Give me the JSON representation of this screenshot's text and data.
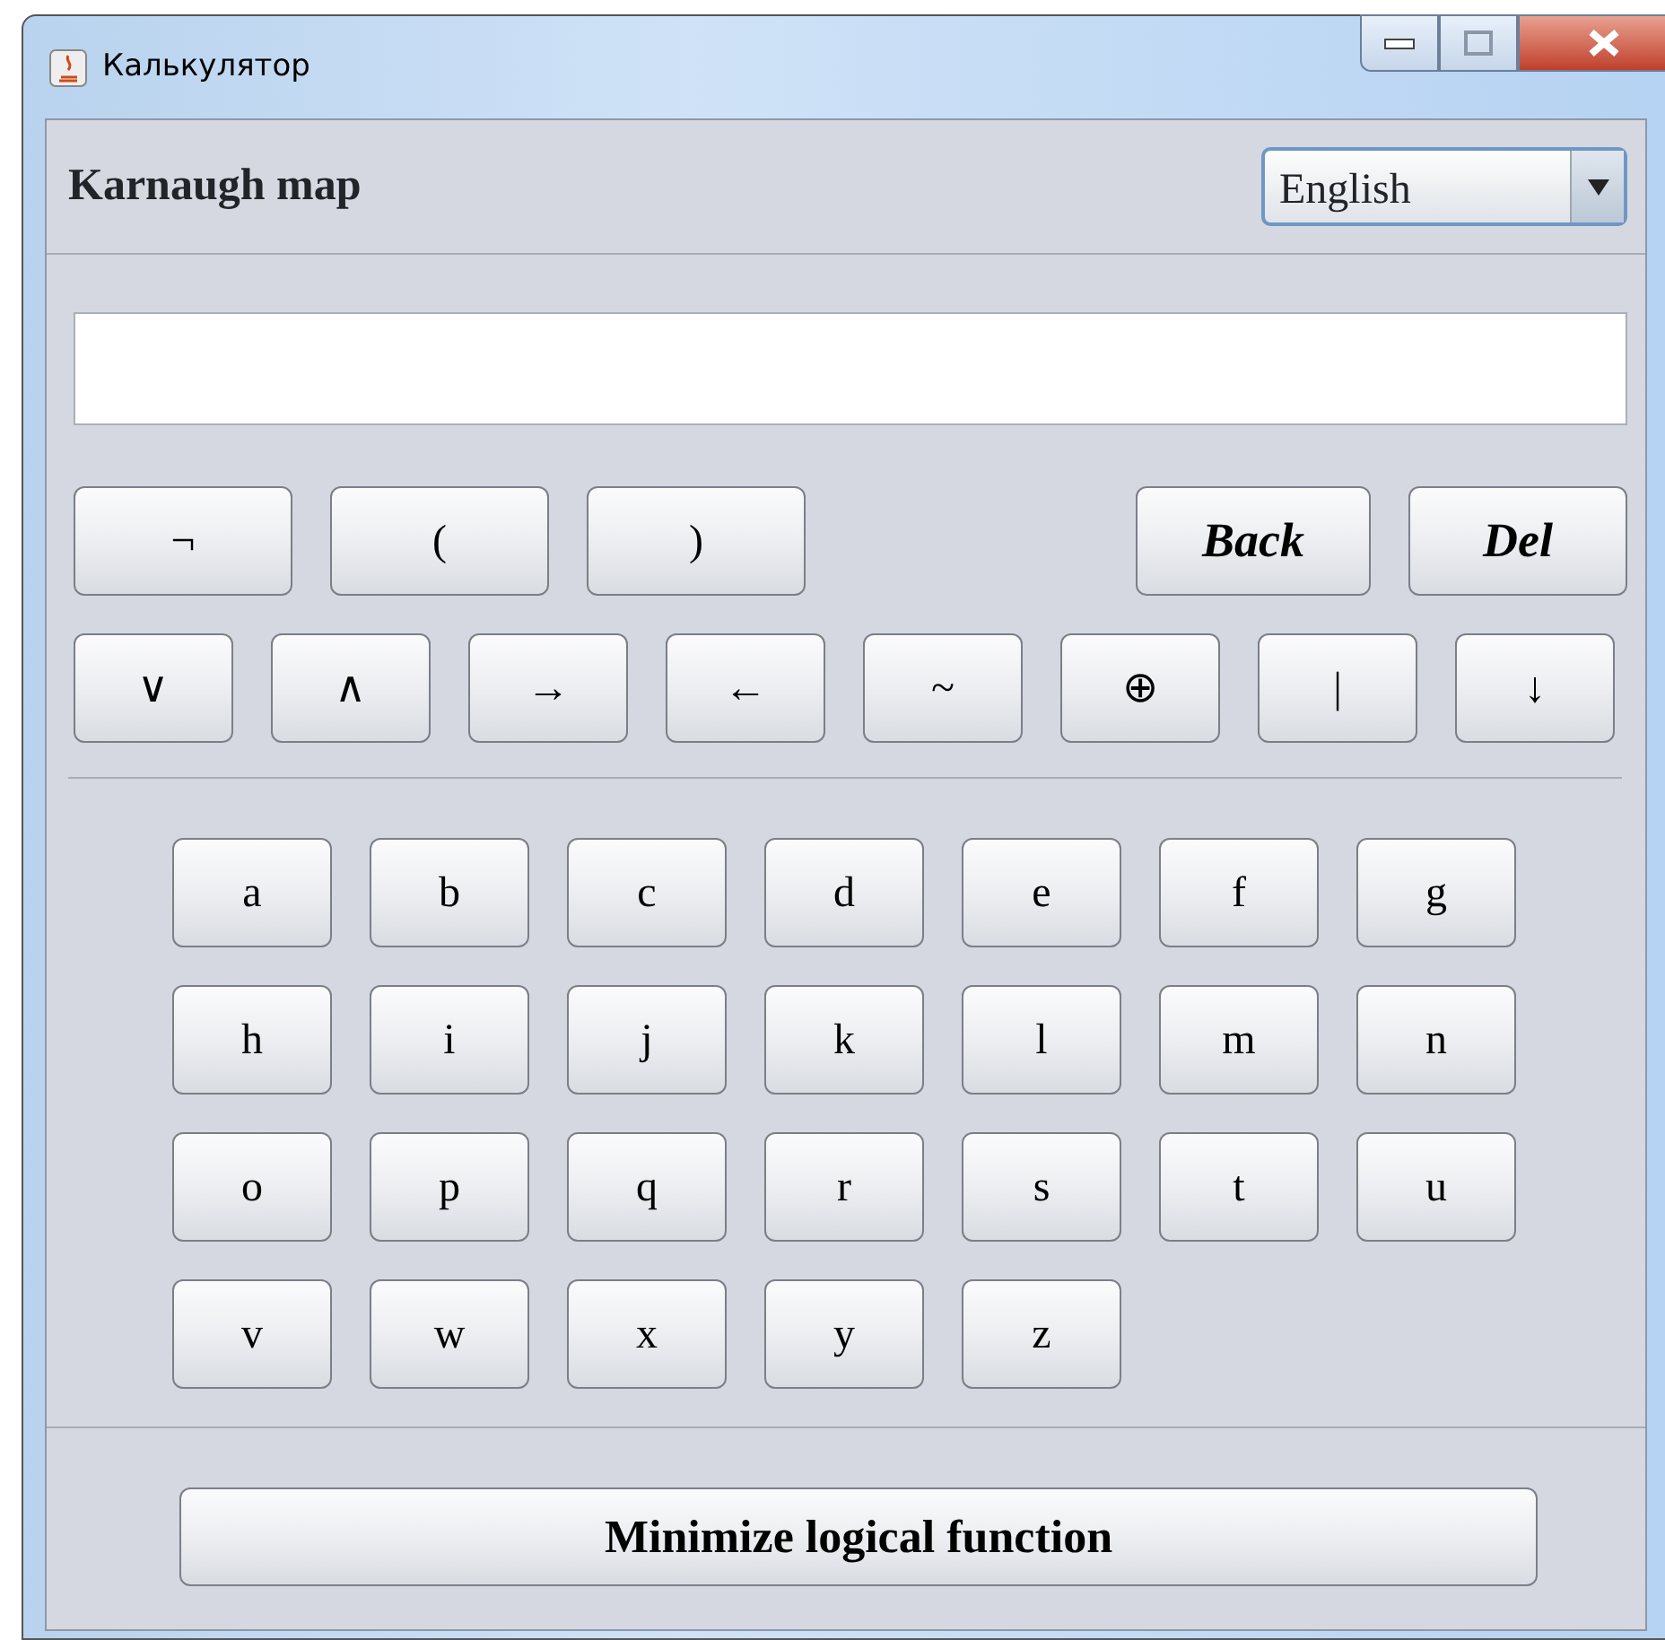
{
  "window": {
    "title": "Калькулятор"
  },
  "header": {
    "title": "Karnaugh map",
    "language": "English"
  },
  "operators_row_1": [
    {
      "label": "¬",
      "kind": "operator"
    },
    {
      "label": "(",
      "kind": "operator"
    },
    {
      "label": ")",
      "kind": "operator"
    },
    {
      "label": "Back",
      "kind": "edit"
    },
    {
      "label": "Del",
      "kind": "edit"
    }
  ],
  "operators_row_2": [
    "∨",
    "∧",
    "→",
    "←",
    "~",
    "⊕",
    "|",
    "↓"
  ],
  "letters": [
    [
      "a",
      "b",
      "c",
      "d",
      "e",
      "f",
      "g"
    ],
    [
      "h",
      "i",
      "j",
      "k",
      "l",
      "m",
      "n"
    ],
    [
      "o",
      "p",
      "q",
      "r",
      "s",
      "t",
      "u"
    ],
    [
      "v",
      "w",
      "x",
      "y",
      "z"
    ]
  ],
  "action_button": "Minimize logical function"
}
